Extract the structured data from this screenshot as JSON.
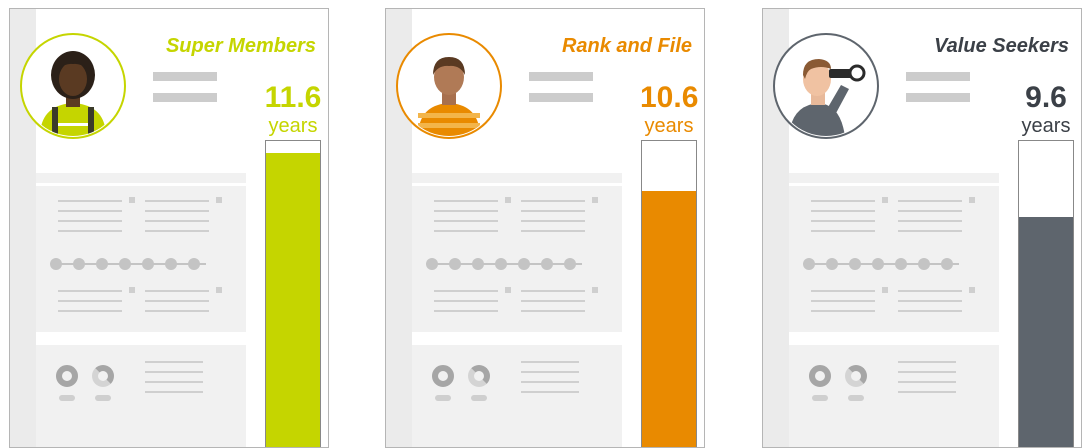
{
  "cards": [
    {
      "title": "Super Members",
      "value": "11.6",
      "unit": "years",
      "fill_fraction": 0.95,
      "accent": "#c5d500",
      "avatar": "woman-with-backpack-icon"
    },
    {
      "title": "Rank and File",
      "value": "10.6",
      "unit": "years",
      "fill_fraction": 0.82,
      "accent": "#e98a00",
      "avatar": "man-in-striped-shirt-icon"
    },
    {
      "title": "Value Seekers",
      "value": "9.6",
      "unit": "years",
      "fill_fraction": 0.73,
      "accent": "#5e656d",
      "title_color": "#3b4047",
      "value_color": "#3b4047",
      "avatar": "man-with-binoculars-icon"
    }
  ]
}
